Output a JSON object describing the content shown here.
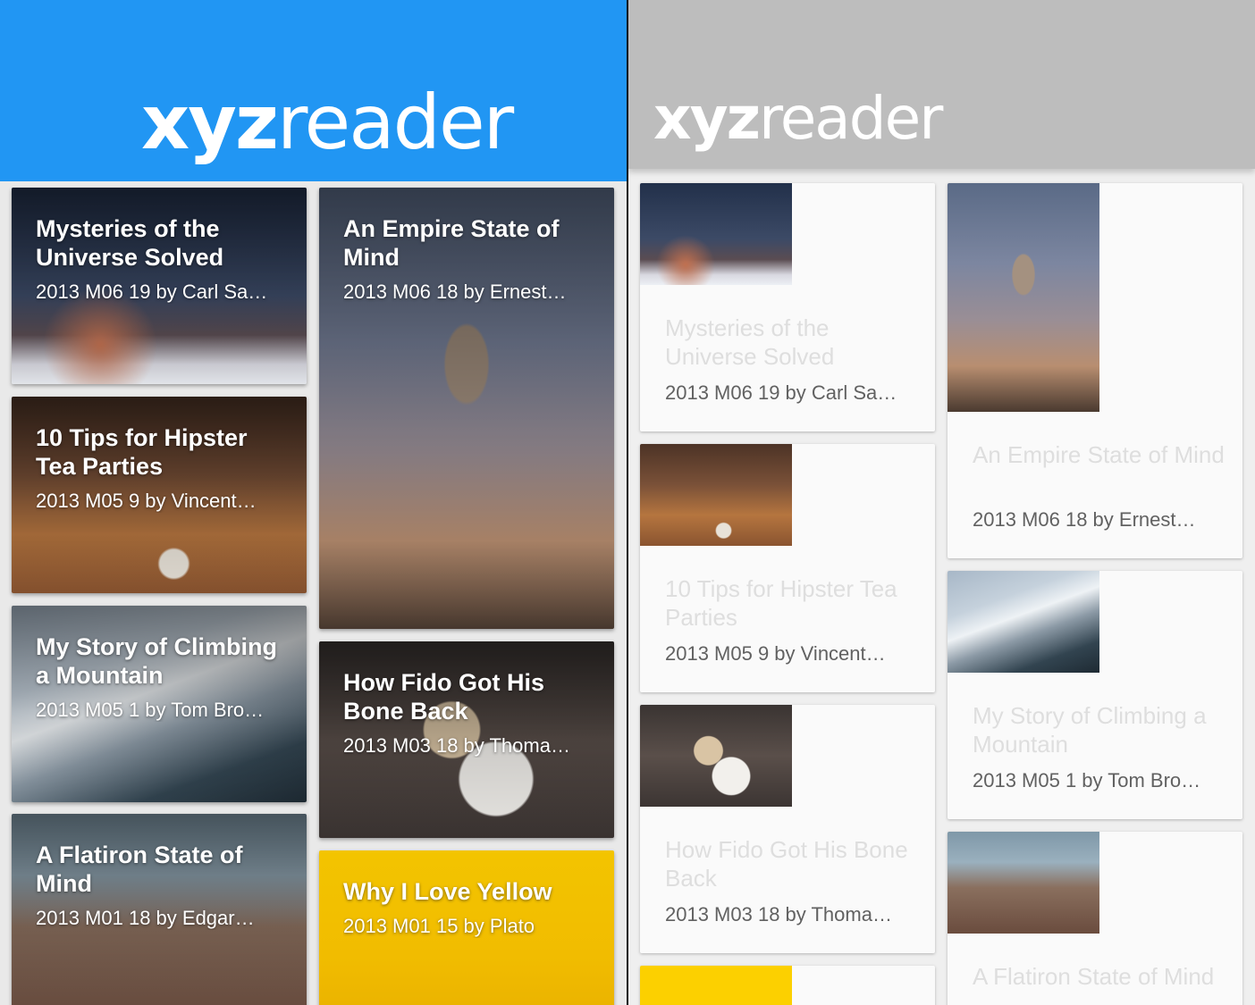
{
  "app": {
    "logo_bold": "xyz",
    "logo_regular": "reader",
    "colors": {
      "appbar_loaded": "#2196f3",
      "appbar_loading": "#bdbdbd"
    }
  },
  "left_articles": [
    {
      "title": "Mysteries of the Universe Solved",
      "meta": "2013 M06 19 by Carl Sa…",
      "image": "night-sky-mountain"
    },
    {
      "title": "An Empire State of Mind",
      "meta": "2013 M06 18 by Ernest…",
      "image": "empire-state-building"
    },
    {
      "title": "10 Tips for Hipster Tea Parties",
      "meta": "2013 M05 9 by Vincent…",
      "image": "tea-cups-table"
    },
    {
      "title": "How Fido Got His Bone Back",
      "meta": "2013 M03 18 by Thoma…",
      "image": "bulldog"
    },
    {
      "title": "My Story of Climbing a Mountain",
      "meta": "2013 M05 1 by Tom Bro…",
      "image": "snowy-mountain"
    },
    {
      "title": "Why I Love Yellow",
      "meta": "2013 M01 15 by Plato",
      "image": "yellow-wall"
    },
    {
      "title": "A Flatiron State of Mind",
      "meta": "2013 M01 18 by Edgar…",
      "image": "flatiron-building"
    }
  ],
  "right_articles": [
    {
      "title": "Mysteries of the Universe Solved",
      "meta": "2013 M06 19 by Carl Sa…"
    },
    {
      "title": "An Empire State of Mind",
      "meta": "2013 M06 18 by Ernest…"
    },
    {
      "title": "10 Tips for Hipster Tea Parties",
      "meta": "2013 M05 9 by Vincent…"
    },
    {
      "title": "My Story of Climbing a Mountain",
      "meta": "2013 M05 1 by Tom Bro…"
    },
    {
      "title": "How Fido Got His Bone Back",
      "meta": "2013 M03 18 by Thoma…"
    },
    {
      "title": "A Flatiron State of Mind",
      "meta": ""
    },
    {
      "title": "",
      "meta": ""
    }
  ]
}
